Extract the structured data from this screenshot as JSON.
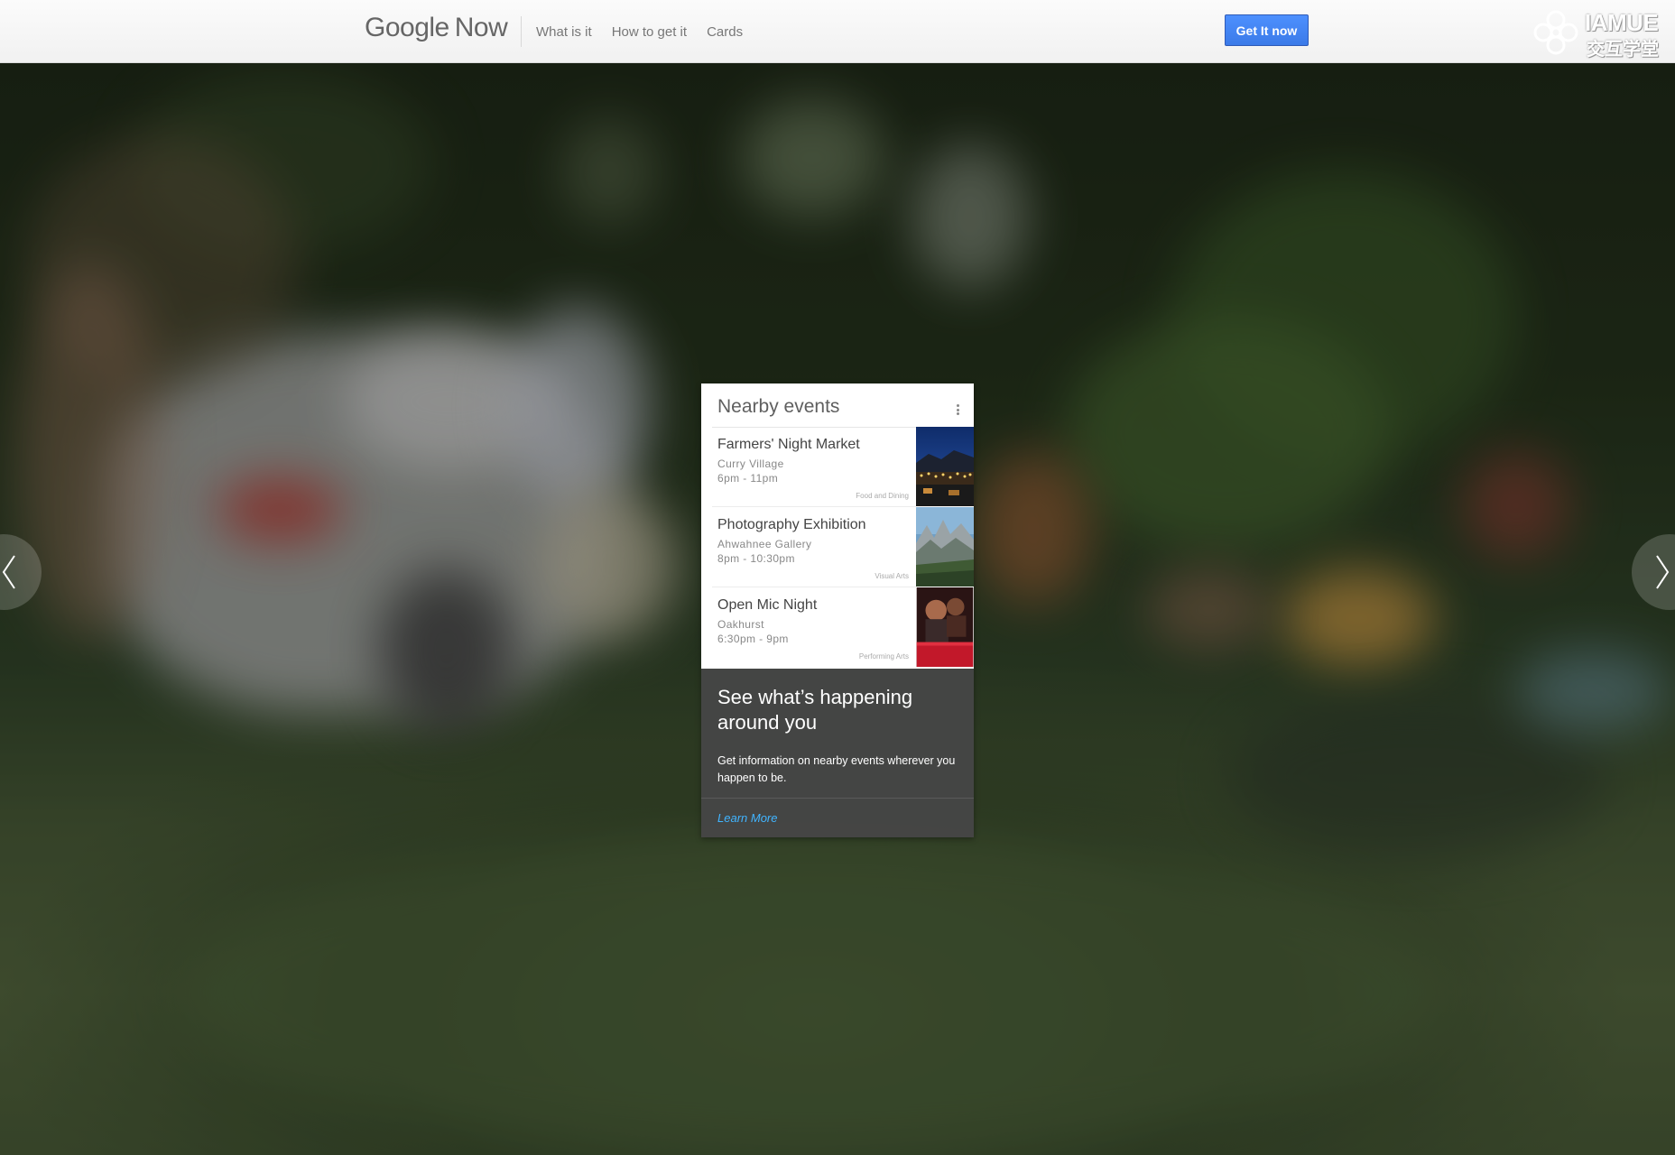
{
  "header": {
    "logo_google": "Google",
    "logo_now": "Now",
    "nav": [
      "What is it",
      "How to get it",
      "Cards"
    ],
    "cta_label": "Get It now",
    "watermark_latin": "IAMUE",
    "watermark_cjk": "交互学堂"
  },
  "card": {
    "title": "Nearby events",
    "events": [
      {
        "name": "Farmers' Night Market",
        "place": "Curry Village",
        "time": "6pm - 11pm",
        "category": "Food and Dining"
      },
      {
        "name": "Photography Exhibition",
        "place": "Ahwahnee Gallery",
        "time": "8pm - 10:30pm",
        "category": "Visual Arts"
      },
      {
        "name": "Open Mic Night",
        "place": "Oakhurst",
        "time": "6:30pm - 9pm",
        "category": "Performing Arts"
      }
    ],
    "headline": "See what’s happening around you",
    "description": "Get information on nearby events wherever you happen to be.",
    "learn_more": "Learn More"
  },
  "colors": {
    "cta_blue": "#4d90fe",
    "link_blue": "#41b4ff",
    "card_dark": "#464646"
  },
  "icons": [
    "kebab-menu-icon",
    "chevron-left-icon",
    "chevron-right-icon",
    "flower-logo-icon"
  ]
}
